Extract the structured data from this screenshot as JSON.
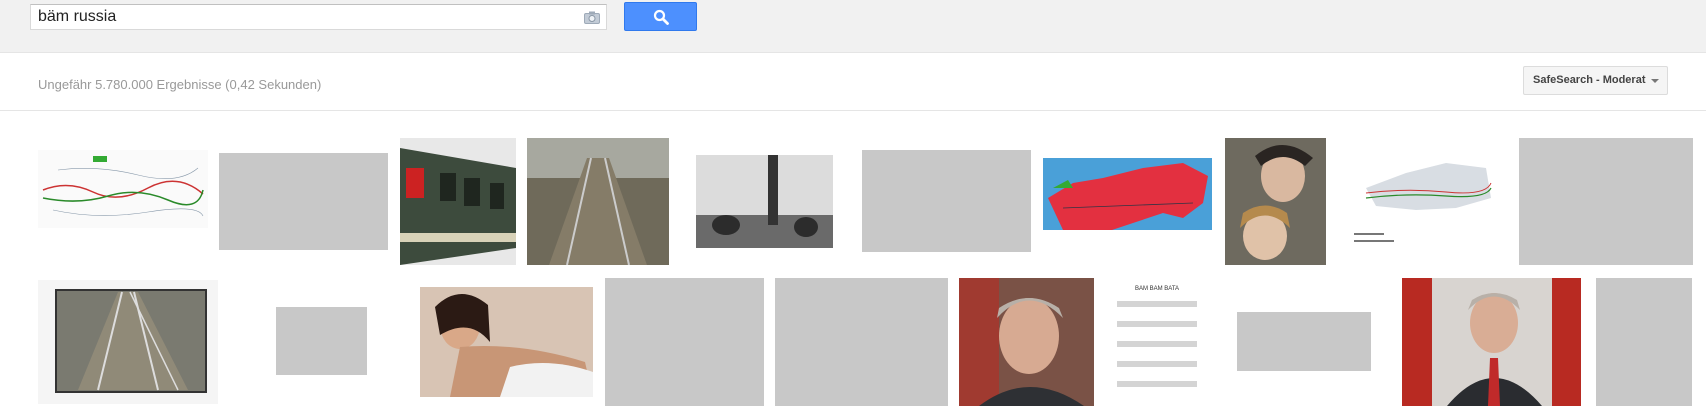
{
  "search": {
    "query": "bäm russia",
    "placeholder": ""
  },
  "toolbar": {
    "search_button_icon": "search-icon",
    "camera_icon": "camera-icon"
  },
  "results": {
    "stats": "Ungefähr 5.780.000 Ergebnisse (0,42 Sekunden)",
    "safesearch_label": "SafeSearch - Moderat"
  },
  "colors": {
    "accent": "#4d90fe",
    "placeholder": "#c8c8c8"
  },
  "sheet_title": "BAM BAM BATA"
}
